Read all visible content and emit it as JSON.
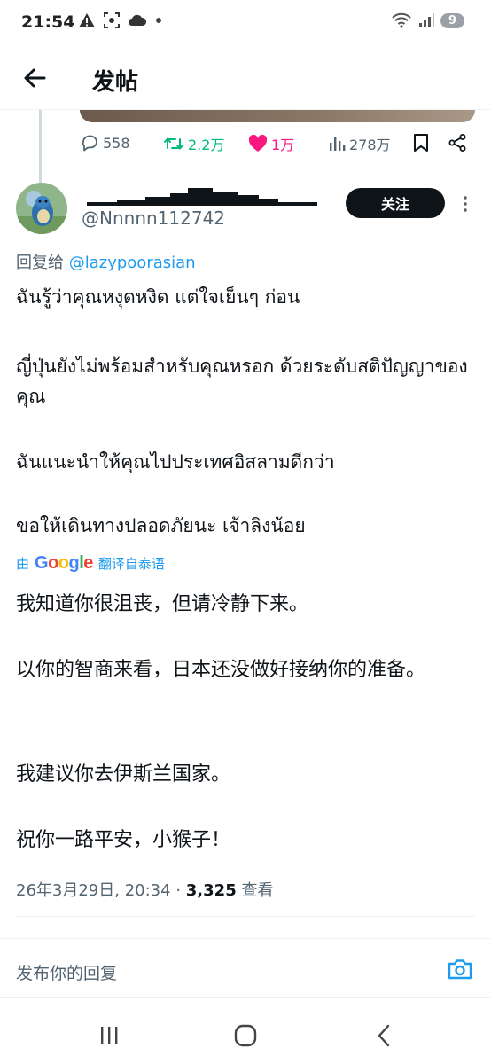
{
  "status": {
    "time": "21:54",
    "battery": "9",
    "icons_left": [
      "warning-icon",
      "screenshot-icon",
      "cloud-icon",
      "dot-icon"
    ],
    "icons_right": [
      "wifi-icon",
      "signal-icon"
    ]
  },
  "header": {
    "title": "发帖"
  },
  "prev_actions": {
    "replies": "558",
    "reposts": "2.2万",
    "likes": "1万",
    "views": "278万",
    "accent_repost": "#00ba7c",
    "accent_like": "#f91880"
  },
  "tweet": {
    "handle": "@Nnnnn112742",
    "follow_label": "关注",
    "reply_prefix": "回复给",
    "reply_mention": "@lazypoorasian",
    "thai": [
      "ฉันรู้ว่าคุณหงุดหงิด แต่ใจเย็นๆ ก่อน",
      "ญี่ปุ่นยังไม่พร้อมสำหรับคุณหรอก ด้วยระดับสติปัญญาของคุณ",
      "ฉันแนะนำให้คุณไปประเทศอิสลามดีกว่า",
      "ขอให้เดินทางปลอดภัยนะ เจ้าลิงน้อย"
    ],
    "translate_prefix": "由",
    "translate_brand": "Google",
    "translate_suffix": "翻译自泰语",
    "zh": [
      "我知道你很沮丧，但请冷静下来。",
      "以你的智商来看，日本还没做好接纳你的准备。",
      "我建议你去伊斯兰国家。",
      "祝你一路平安，小猴子！"
    ],
    "timestamp": "26年3月29日, 20:34",
    "separator": "·",
    "views_count": "3,325",
    "views_label": "查看"
  },
  "reply_bar": {
    "placeholder": "发布你的回复"
  },
  "colors": {
    "link": "#1d9bf0",
    "text": "#0f1419",
    "muted": "#536471"
  }
}
